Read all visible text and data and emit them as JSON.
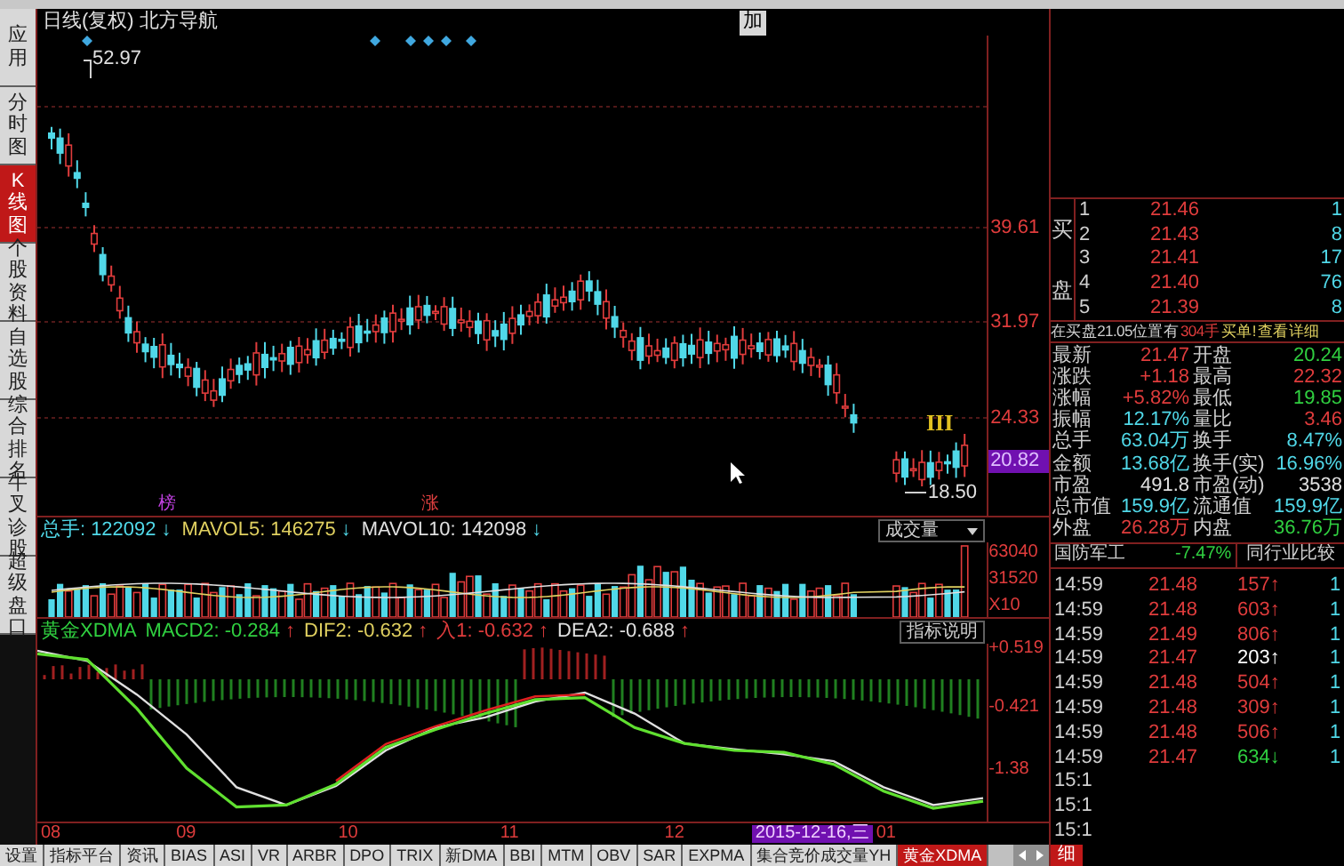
{
  "title": "日线(复权) 北方导航",
  "top_button": "加",
  "sidebar": [
    {
      "label": "应用",
      "selected": false
    },
    {
      "label": "分时图",
      "selected": false
    },
    {
      "label": "K线图",
      "selected": true
    },
    {
      "label": "个股资料",
      "selected": false
    },
    {
      "label": "自选股",
      "selected": false
    },
    {
      "label": "综合排名",
      "selected": false
    },
    {
      "label": "牛叉诊股",
      "selected": false
    },
    {
      "label": "超级盘口",
      "selected": false
    }
  ],
  "price_chart": {
    "high_label": "52.97",
    "low_label": "18.50",
    "signal_mark": "III",
    "markers": [
      {
        "text": "榜",
        "color": "#c040e0"
      },
      {
        "text": "涨",
        "color": "#e04040"
      }
    ],
    "axis": [
      {
        "label": "39.61",
        "selected": false
      },
      {
        "label": "31.97",
        "selected": false
      },
      {
        "label": "24.33",
        "selected": false
      },
      {
        "label": "20.82",
        "selected": true
      }
    ]
  },
  "volume": {
    "readings": [
      {
        "label": "总手:",
        "value": "122092",
        "arrow": "↓",
        "color": "#50d8e8"
      },
      {
        "label": "MAVOL5:",
        "value": "146275",
        "arrow": "↓",
        "color": "#e0d060"
      },
      {
        "label": "MAVOL10:",
        "value": "142098",
        "arrow": "↓",
        "color": "#e0e0e0"
      }
    ],
    "selector": "成交量",
    "axis": [
      "63040",
      "31520",
      "X10"
    ]
  },
  "macd": {
    "name": "黄金XDMA",
    "readings": [
      {
        "label": "MACD2:",
        "value": "-0.284",
        "arrow": "↑",
        "color": "#30d040"
      },
      {
        "label": "DIF2:",
        "value": "-0.632",
        "arrow": "↑",
        "color": "#e0d060"
      },
      {
        "label": "入1:",
        "value": "-0.632",
        "arrow": "↑",
        "color": "#e03c3c"
      },
      {
        "label": "DEA2:",
        "value": "-0.688",
        "arrow": "↑",
        "color": "#e0e0e0"
      }
    ],
    "help_button": "指标说明",
    "chart_data": {
      "type": "line",
      "ylim": [
        -2.2,
        0.6
      ],
      "yticks": [
        {
          "value": 0.519,
          "label": "+0.519"
        },
        {
          "value": -0.421,
          "label": "-0.421"
        },
        {
          "value": -1.38,
          "label": "-1.38"
        }
      ],
      "series": [
        {
          "color": "#e0e0e0",
          "values": [
            0.49,
            0.33,
            -0.2,
            -0.83,
            -1.66,
            -1.94,
            -1.64,
            -1.08,
            -0.72,
            -0.56,
            -0.31,
            -0.17,
            -0.5,
            -0.97,
            -1.06,
            -1.14,
            -1.25,
            -1.66,
            -1.94,
            -1.83
          ]
        },
        {
          "color": "#60e030",
          "values": [
            0.44,
            0.35,
            -0.42,
            -1.36,
            -1.97,
            -1.94,
            -1.61,
            -1.03,
            -0.75,
            -0.5,
            -0.28,
            -0.25,
            -0.72,
            -0.97,
            -1.08,
            -1.11,
            -1.3,
            -1.72,
            -1.99,
            -1.88
          ]
        },
        {
          "color": "#e02020",
          "values": [
            null,
            null,
            null,
            null,
            null,
            null,
            -1.56,
            -0.98,
            -0.7,
            -0.45,
            -0.23,
            -0.2,
            null,
            null,
            null,
            null,
            null,
            null,
            null,
            null
          ]
        }
      ]
    }
  },
  "x_axis": [
    {
      "label": "08",
      "selected": false
    },
    {
      "label": "09",
      "selected": false
    },
    {
      "label": "10",
      "selected": false
    },
    {
      "label": "11",
      "selected": false
    },
    {
      "label": "12",
      "selected": false
    },
    {
      "label": "2015-12-16,三",
      "selected": true
    },
    {
      "label": "01",
      "selected": false
    }
  ],
  "tabs": [
    {
      "label": "设置",
      "selected": false
    },
    {
      "label": "指标平台",
      "selected": false
    },
    {
      "label": "资讯",
      "selected": false
    },
    {
      "label": "BIAS",
      "selected": false
    },
    {
      "label": "ASI",
      "selected": false
    },
    {
      "label": "VR",
      "selected": false
    },
    {
      "label": "ARBR",
      "selected": false
    },
    {
      "label": "DPO",
      "selected": false
    },
    {
      "label": "TRIX",
      "selected": false
    },
    {
      "label": "新DMA",
      "selected": false
    },
    {
      "label": "BBI",
      "selected": false
    },
    {
      "label": "MTM",
      "selected": false
    },
    {
      "label": "OBV",
      "selected": false
    },
    {
      "label": "SAR",
      "selected": false
    },
    {
      "label": "EXPMA",
      "selected": false
    },
    {
      "label": "集合竞价成交量YH",
      "selected": false
    },
    {
      "label": "黄金XDMA",
      "selected": true
    }
  ],
  "order_book": {
    "side_label": [
      "买",
      "盘"
    ],
    "rows": [
      {
        "level": "1",
        "price": "21.46",
        "volume": "1"
      },
      {
        "level": "2",
        "price": "21.43",
        "volume": "8"
      },
      {
        "level": "3",
        "price": "21.41",
        "volume": "17"
      },
      {
        "level": "4",
        "price": "21.40",
        "volume": "76"
      },
      {
        "level": "5",
        "price": "21.39",
        "volume": "8"
      }
    ]
  },
  "notice": {
    "text": "在买盘21.05位置有",
    "amount": "304手",
    "tail": "买单!",
    "link": "查看详细"
  },
  "quotes": [
    {
      "left": {
        "label": "最新",
        "value": "21.47",
        "color": "#e03c3c"
      },
      "right": {
        "label": "开盘",
        "value": "20.24",
        "color": "#30d040"
      }
    },
    {
      "left": {
        "label": "涨跌",
        "value": "+1.18",
        "color": "#e03c3c"
      },
      "right": {
        "label": "最高",
        "value": "22.32",
        "color": "#e03c3c"
      }
    },
    {
      "left": {
        "label": "涨幅",
        "value": "+5.82%",
        "color": "#e03c3c"
      },
      "right": {
        "label": "最低",
        "value": "19.85",
        "color": "#30d040"
      }
    },
    {
      "left": {
        "label": "振幅",
        "value": "12.17%",
        "color": "#50d8e8"
      },
      "right": {
        "label": "量比",
        "value": "3.46",
        "color": "#e03c3c"
      }
    },
    {
      "left": {
        "label": "总手",
        "value": "63.04万",
        "color": "#50d8e8"
      },
      "right": {
        "label": "换手",
        "value": "8.47%",
        "color": "#50d8e8"
      }
    },
    {
      "left": {
        "label": "金额",
        "value": "13.68亿",
        "color": "#50d8e8"
      },
      "right": {
        "label": "换手(实)",
        "value": "16.96%",
        "color": "#50d8e8"
      }
    },
    {
      "left": {
        "label": "市盈",
        "value": "491.8",
        "color": "#e0e0e0"
      },
      "right": {
        "label": "市盈(动)",
        "value": "3538",
        "color": "#e0e0e0"
      }
    },
    {
      "left": {
        "label": "总市值",
        "value": "159.9亿",
        "color": "#50d8e8"
      },
      "right": {
        "label": "流通值",
        "value": "159.9亿",
        "color": "#50d8e8"
      }
    },
    {
      "left": {
        "label": "外盘",
        "value": "26.28万",
        "color": "#e03c3c"
      },
      "right": {
        "label": "内盘",
        "value": "36.76万",
        "color": "#30d040"
      }
    }
  ],
  "sector": {
    "name": "国防军工",
    "change": "-7.47%",
    "button": "同行业比较"
  },
  "ticks": [
    {
      "time": "14:59",
      "price": "21.48",
      "volume": "157",
      "arrow": "↑",
      "color": "#e03c3c",
      "flag": "1"
    },
    {
      "time": "14:59",
      "price": "21.48",
      "volume": "603",
      "arrow": "↑",
      "color": "#e03c3c",
      "flag": "1"
    },
    {
      "time": "14:59",
      "price": "21.49",
      "volume": "806",
      "arrow": "↑",
      "color": "#e03c3c",
      "flag": "1"
    },
    {
      "time": "14:59",
      "price": "21.47",
      "volume": "203",
      "arrow": "↑",
      "color": "#ffffff",
      "flag": "1"
    },
    {
      "time": "14:59",
      "price": "21.48",
      "volume": "504",
      "arrow": "↑",
      "color": "#e03c3c",
      "flag": "1"
    },
    {
      "time": "14:59",
      "price": "21.48",
      "volume": "309",
      "arrow": "↑",
      "color": "#e03c3c",
      "flag": "1"
    },
    {
      "time": "14:59",
      "price": "21.48",
      "volume": "506",
      "arrow": "↑",
      "color": "#e03c3c",
      "flag": "1"
    },
    {
      "time": "14:59",
      "price": "21.47",
      "volume": "634",
      "arrow": "↓",
      "color": "#30d040",
      "flag": "1"
    }
  ],
  "cut_times": [
    "15:1",
    "15:1",
    "15:1"
  ],
  "detail_tab": "细"
}
